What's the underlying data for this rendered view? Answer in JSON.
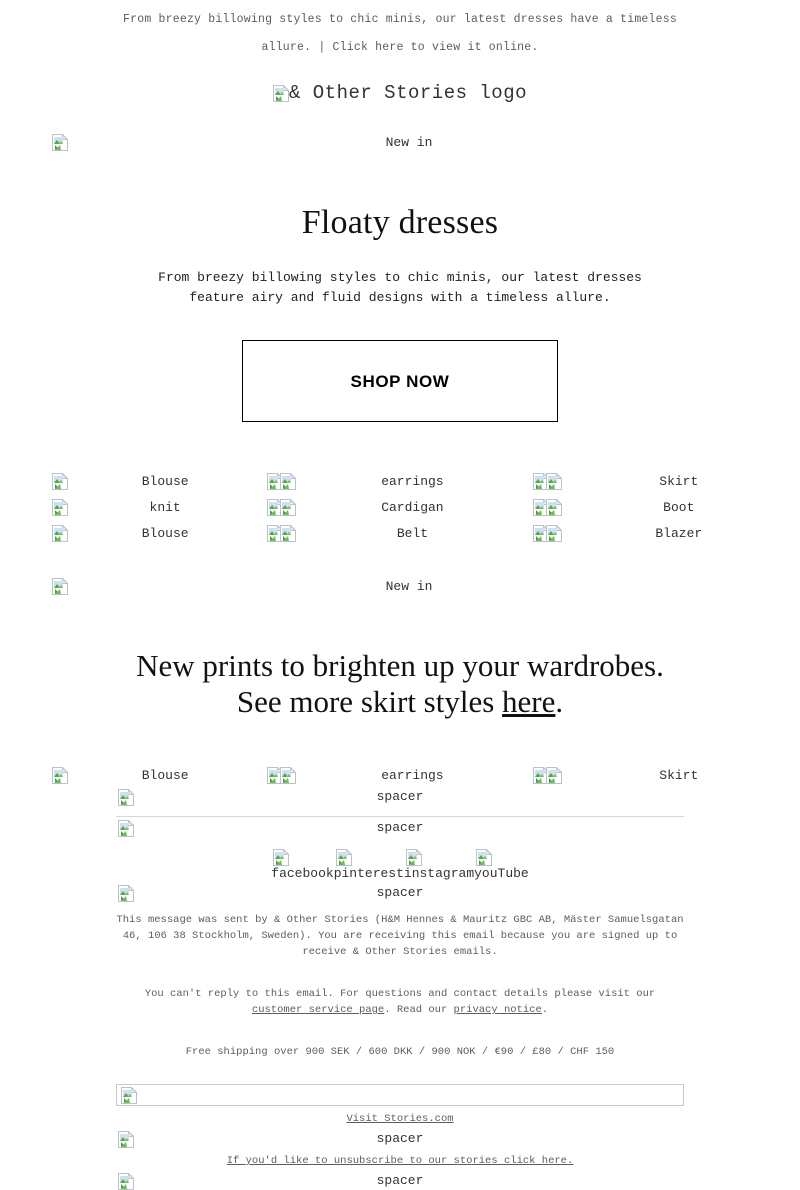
{
  "preheader": {
    "text": "From breezy billowing styles to chic minis, our latest dresses have a timeless allure.",
    "separator": "|",
    "view_online": "Click here to view it online."
  },
  "logo": {
    "alt": "& Other Stories logo",
    "icon": "broken-image-icon"
  },
  "banner_top": {
    "alt": "New in",
    "icon": "broken-image-icon"
  },
  "hero": {
    "title": "Floaty dresses",
    "body": "From breezy billowing styles to chic minis, our latest dresses feature airy and fluid designs with a timeless allure.",
    "cta_label": "SHOP NOW"
  },
  "product_grid_1": {
    "rows": [
      [
        {
          "alt": "Blouse",
          "icons": 1
        },
        {
          "alt": "earrings",
          "icons": 2
        },
        {
          "alt": "Skirt",
          "icons": 2
        }
      ],
      [
        {
          "alt": "knit",
          "icons": 1
        },
        {
          "alt": "Cardigan",
          "icons": 2
        },
        {
          "alt": "Boot",
          "icons": 2
        }
      ],
      [
        {
          "alt": "Blouse",
          "icons": 1
        },
        {
          "alt": "Belt",
          "icons": 2
        },
        {
          "alt": "Blazer",
          "icons": 2
        }
      ]
    ]
  },
  "banner_mid": {
    "alt": "New in",
    "icon": "broken-image-icon"
  },
  "editorial": {
    "line1": "New prints to brighten up your wardrobes.",
    "line2_before": "See more skirt styles ",
    "link": "here",
    "line2_after": "."
  },
  "product_grid_2": {
    "rows": [
      [
        {
          "alt": "Blouse",
          "icons": 1
        },
        {
          "alt": "earrings",
          "icons": 2
        },
        {
          "alt": "Skirt",
          "icons": 2
        }
      ]
    ]
  },
  "spacers": {
    "label": "spacer"
  },
  "social": {
    "items": [
      {
        "label": "facebook",
        "icon": "broken-image-icon"
      },
      {
        "label": "pinterest",
        "icon": "broken-image-icon"
      },
      {
        "label": "instagram",
        "icon": "broken-image-icon"
      },
      {
        "label": "youTube",
        "icon": "broken-image-icon"
      }
    ]
  },
  "footer": {
    "legal": "This message was sent by & Other Stories (H&M Hennes & Mauritz GBC AB, Mäster Samuelsgatan 46, 106 38 Stockholm, Sweden). You are receiving this email because you are signed up to receive & Other Stories emails.",
    "contact_before": "You can't reply to this email. For questions and contact details please visit our ",
    "contact_link1": "customer service page",
    "contact_mid": ". Read our ",
    "contact_link2": "privacy notice",
    "contact_after": ".",
    "shipping": "Free shipping over 900 SEK / 600 DKK / 900 NOK / €90 / £80 / CHF 150",
    "visit_link": "Visit Stories.com",
    "unsubscribe_link": "If you'd like to unsubscribe to our stories click here."
  }
}
